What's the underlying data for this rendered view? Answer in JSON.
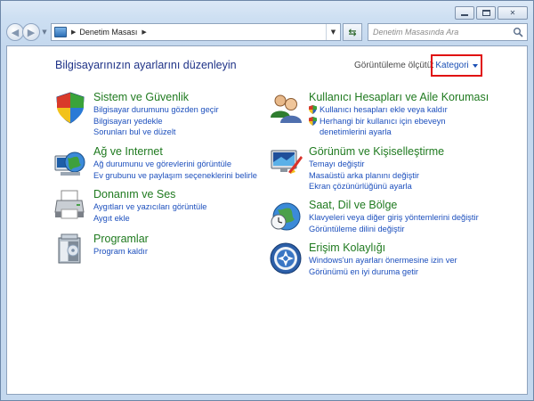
{
  "navigation": {
    "address_path": "Denetim Masası",
    "search_placeholder": "Denetim Masasında Ara"
  },
  "main": {
    "title": "Bilgisayarınızın ayarlarını düzenleyin",
    "view_by_label": "Görüntüleme ölçütü:",
    "view_by_value": "Kategori"
  },
  "categories": [
    {
      "title": "Sistem ve Güvenlik",
      "links": [
        "Bilgisayar durumunu gözden geçir",
        "Bilgisayarı yedekle",
        "Sorunları bul ve düzelt"
      ],
      "icon": "shield-icon"
    },
    {
      "title": "Ağ ve Internet",
      "links": [
        "Ağ durumunu ve görevlerini görüntüle",
        "Ev grubunu ve paylaşım seçeneklerini belirle"
      ],
      "icon": "network-globe-icon"
    },
    {
      "title": "Donanım ve Ses",
      "links": [
        "Aygıtları ve yazıcıları görüntüle",
        "Aygıt ekle"
      ],
      "icon": "printer-icon"
    },
    {
      "title": "Programlar",
      "links": [
        "Program kaldır"
      ],
      "icon": "programs-box-icon"
    },
    {
      "title": "Kullanıcı Hesapları ve Aile Koruması",
      "links": [
        "Kullanıcı hesapları ekle veya kaldır",
        "Herhangi bir kullanıcı için ebeveyn",
        "denetimlerini ayarla"
      ],
      "icon": "users-icon"
    },
    {
      "title": "Görünüm ve Kişiselleştirme",
      "links": [
        "Temayı değiştir",
        "Masaüstü arka planını değiştir",
        "Ekran çözünürlüğünü ayarla"
      ],
      "icon": "monitor-paint-icon"
    },
    {
      "title": "Saat, Dil ve Bölge",
      "links": [
        "Klavyeleri veya diğer giriş yöntemlerini değiştir",
        "Görüntüleme dilini değiştir"
      ],
      "icon": "clock-globe-icon"
    },
    {
      "title": "Erişim Kolaylığı",
      "links": [
        "Windows'un ayarları önermesine izin ver",
        "Görünümü en iyi duruma getir"
      ],
      "icon": "ease-of-access-icon"
    }
  ]
}
